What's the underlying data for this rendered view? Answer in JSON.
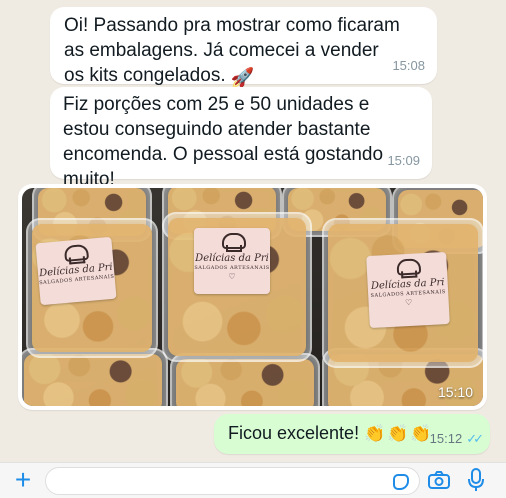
{
  "messages": [
    {
      "text": "Oi! Passando pra mostrar como ficaram\nas embalagens. Já comecei a vender\nos kits congelados. ",
      "emoji": "🚀",
      "time": "15:08"
    },
    {
      "text": "Fiz porções com 25 e 50 unidades e\nestou conseguindo atender bastante\nencomenda. O pessoal está gostando muito!",
      "time": "15:09"
    }
  ],
  "photo": {
    "time": "15:10",
    "label_name": "Delícias da Pri",
    "label_sub": "SALGADOS ARTESANAIS",
    "label_heart": "♡"
  },
  "reply": {
    "text": "Ficou excelente! ",
    "emoji": "👏👏👏",
    "time": "15:12",
    "ticks": "✓✓"
  },
  "composer": {
    "plus": "+"
  },
  "colors": {
    "background": "#efeae2",
    "incoming": "#ffffff",
    "outgoing": "#d9fdd3",
    "accent": "#1f8de8",
    "read_ticks": "#53bdeb"
  },
  "icons": [
    "plus-icon",
    "sticker-icon",
    "camera-icon",
    "microphone-icon",
    "double-check-icon",
    "rocket-emoji",
    "clap-emoji"
  ]
}
